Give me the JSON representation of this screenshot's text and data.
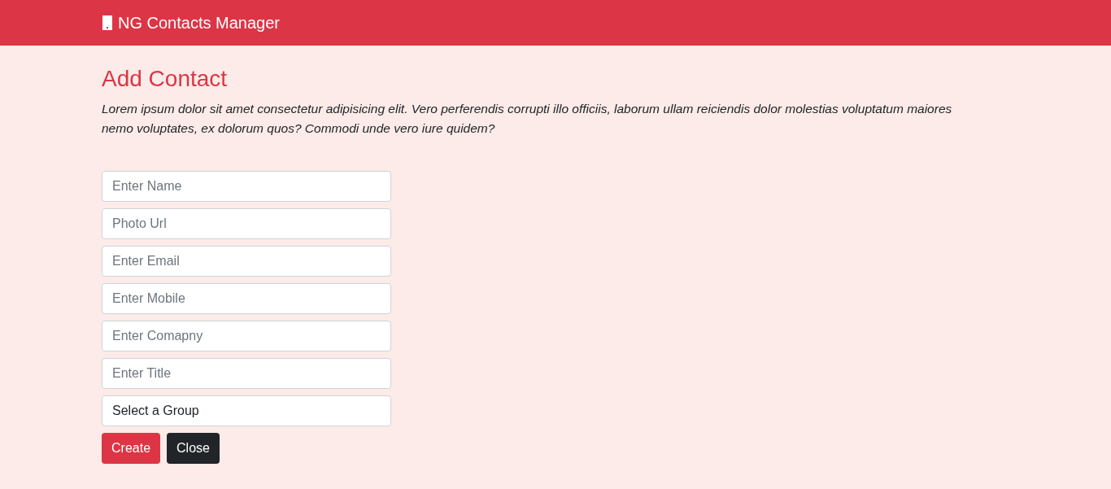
{
  "navbar": {
    "brand": "NG Contacts Manager"
  },
  "page": {
    "title": "Add Contact",
    "description": "Lorem ipsum dolor sit amet consectetur adipisicing elit. Vero perferendis corrupti illo officiis, laborum ullam reiciendis dolor molestias voluptatum maiores nemo voluptates, ex dolorum quos? Commodi unde vero iure quidem?"
  },
  "form": {
    "fields": [
      {
        "kind": "input",
        "placeholder": "Enter Name"
      },
      {
        "kind": "input",
        "placeholder": "Photo Url"
      },
      {
        "kind": "input",
        "placeholder": "Enter Email"
      },
      {
        "kind": "input",
        "placeholder": "Enter Mobile"
      },
      {
        "kind": "input",
        "placeholder": "Enter Comapny"
      },
      {
        "kind": "input",
        "placeholder": "Enter Title"
      },
      {
        "kind": "select",
        "value": "Select a Group"
      }
    ],
    "buttons": [
      {
        "kind": "primary",
        "label": "Create"
      },
      {
        "kind": "dark",
        "label": "Close"
      }
    ]
  }
}
